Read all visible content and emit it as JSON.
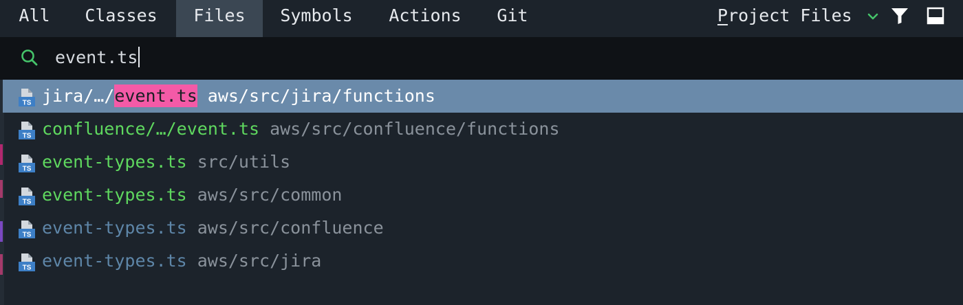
{
  "tabs": [
    {
      "label": "All",
      "active": false
    },
    {
      "label": "Classes",
      "active": false
    },
    {
      "label": "Files",
      "active": true
    },
    {
      "label": "Symbols",
      "active": false
    },
    {
      "label": "Actions",
      "active": false
    },
    {
      "label": "Git",
      "active": false
    }
  ],
  "scope": {
    "mnemonic": "P",
    "rest": "roject Files",
    "dropdown_icon": "chevron-down-icon",
    "filter_icon": "filter-icon",
    "pin_icon": "pin-window-icon"
  },
  "search": {
    "icon": "search-icon",
    "query": "event.ts"
  },
  "results": [
    {
      "prefix": "jira/…/",
      "match": "event.ts",
      "name": "",
      "path": "aws/src/jira/functions",
      "selected": true,
      "status": "selected",
      "icon": "typescript-file-icon"
    },
    {
      "prefix": "",
      "match": "",
      "name": "confluence/…/event.ts",
      "path": "aws/src/confluence/functions",
      "selected": false,
      "status": "added",
      "icon": "typescript-file-icon"
    },
    {
      "prefix": "",
      "match": "",
      "name": "event-types.ts",
      "path": "src/utils",
      "selected": false,
      "status": "added",
      "icon": "typescript-file-icon"
    },
    {
      "prefix": "",
      "match": "",
      "name": "event-types.ts",
      "path": "aws/src/common",
      "selected": false,
      "status": "added",
      "icon": "typescript-file-icon"
    },
    {
      "prefix": "",
      "match": "",
      "name": "event-types.ts",
      "path": "aws/src/confluence",
      "selected": false,
      "status": "unchanged",
      "icon": "typescript-file-icon"
    },
    {
      "prefix": "",
      "match": "",
      "name": "event-types.ts",
      "path": "aws/src/jira",
      "selected": false,
      "status": "unchanged",
      "icon": "typescript-file-icon"
    }
  ],
  "colors": {
    "background": "#1c232b",
    "active_tab": "#3b4753",
    "search_background": "#0f1216",
    "selection": "#6a8aaa",
    "highlight": "#f45aa7",
    "added_file": "#5fd85f",
    "unchanged_file": "#5e86a8",
    "path_text": "#8a929b",
    "accent_green": "#45c46a",
    "ts_badge": "#3d7fc6"
  }
}
